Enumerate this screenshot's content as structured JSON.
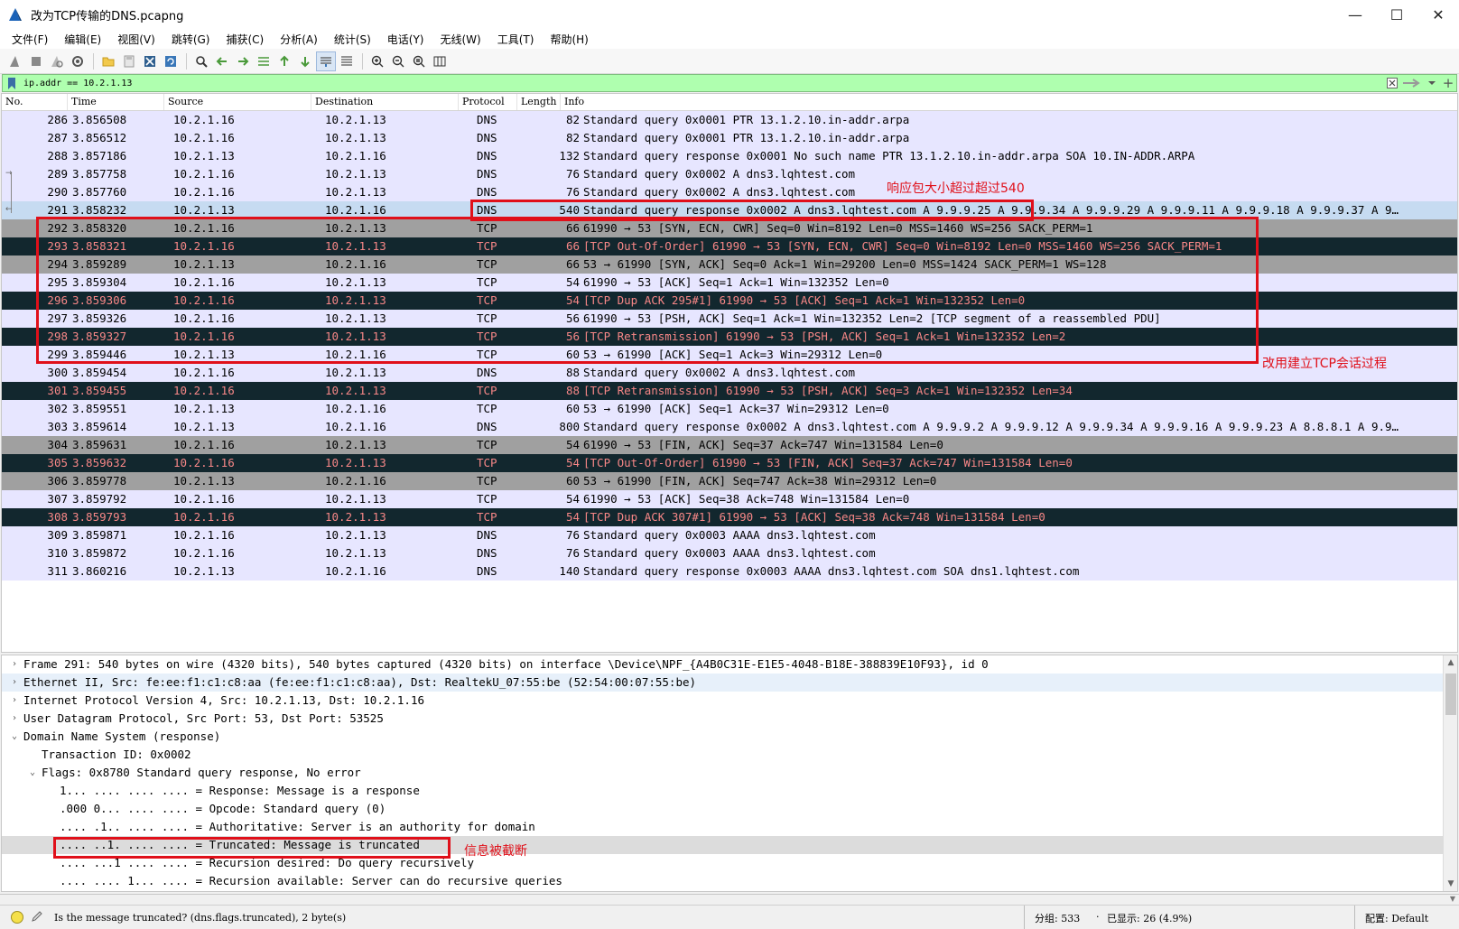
{
  "window": {
    "title": "改为TCP传输的DNS.pcapng",
    "minimize": "—",
    "maximize": "☐",
    "close": "✕"
  },
  "menu": [
    "文件(F)",
    "编辑(E)",
    "视图(V)",
    "跳转(G)",
    "捕获(C)",
    "分析(A)",
    "统计(S)",
    "电话(Y)",
    "无线(W)",
    "工具(T)",
    "帮助(H)"
  ],
  "toolbar_icons": [
    "shark-fin-start-icon",
    "stop-icon",
    "restart-icon",
    "options-gear-icon",
    "open-folder-icon",
    "save-icon",
    "close-file-icon",
    "reload-icon",
    "find-icon",
    "go-back-icon",
    "go-forward-icon",
    "go-to-packet-icon",
    "first-packet-icon",
    "last-packet-icon",
    "autoscroll-icon",
    "colorize-icon",
    "zoom-in-icon",
    "zoom-out-icon",
    "zoom-normal-icon",
    "resize-columns-icon"
  ],
  "filter": {
    "value": "ip.addr == 10.2.1.13",
    "bg_color": "#afffaf"
  },
  "columns": [
    "No.",
    "Time",
    "Source",
    "Destination",
    "Protocol",
    "Length",
    "Info"
  ],
  "colors": {
    "dns_bg": "#e7e6ff",
    "tcp_gray_bg": "#a0a0a0",
    "tcp_light_bg": "#e7e6ff",
    "bad_bg": "#12272e",
    "bad_fg": "#f78787",
    "selected_bg": "#c6dbf1",
    "tcp_plain_bg": "#e7e6ff",
    "annotation": "#e0101a"
  },
  "packets": [
    {
      "no": "286",
      "time": "3.856508",
      "src": "10.2.1.16",
      "dst": "10.2.1.13",
      "proto": "DNS",
      "len": "82",
      "info": "Standard query 0x0001 PTR 13.1.2.10.in-addr.arpa",
      "style": "dns"
    },
    {
      "no": "287",
      "time": "3.856512",
      "src": "10.2.1.16",
      "dst": "10.2.1.13",
      "proto": "DNS",
      "len": "82",
      "info": "Standard query 0x0001 PTR 13.1.2.10.in-addr.arpa",
      "style": "dns"
    },
    {
      "no": "288",
      "time": "3.857186",
      "src": "10.2.1.13",
      "dst": "10.2.1.16",
      "proto": "DNS",
      "len": "132",
      "info": "Standard query response 0x0001 No such name PTR 13.1.2.10.in-addr.arpa SOA 10.IN-ADDR.ARPA",
      "style": "dns"
    },
    {
      "no": "289",
      "time": "3.857758",
      "src": "10.2.1.16",
      "dst": "10.2.1.13",
      "proto": "DNS",
      "len": "76",
      "info": "Standard query 0x0002 A dns3.lqhtest.com",
      "style": "dns"
    },
    {
      "no": "290",
      "time": "3.857760",
      "src": "10.2.1.16",
      "dst": "10.2.1.13",
      "proto": "DNS",
      "len": "76",
      "info": "Standard query 0x0002 A dns3.lqhtest.com",
      "style": "dns"
    },
    {
      "no": "291",
      "time": "3.858232",
      "src": "10.2.1.13",
      "dst": "10.2.1.16",
      "proto": "DNS",
      "len": "540",
      "info": "Standard query response 0x0002 A dns3.lqhtest.com A 9.9.9.25 A 9.9.9.34 A 9.9.9.29 A 9.9.9.11 A 9.9.9.18 A 9.9.9.37 A 9…",
      "style": "selected"
    },
    {
      "no": "292",
      "time": "3.858320",
      "src": "10.2.1.16",
      "dst": "10.2.1.13",
      "proto": "TCP",
      "len": "66",
      "info": "61990 → 53 [SYN, ECN, CWR] Seq=0 Win=8192 Len=0 MSS=1460 WS=256 SACK_PERM=1",
      "style": "gray"
    },
    {
      "no": "293",
      "time": "3.858321",
      "src": "10.2.1.16",
      "dst": "10.2.1.13",
      "proto": "TCP",
      "len": "66",
      "info": "[TCP Out-Of-Order] 61990 → 53 [SYN, ECN, CWR] Seq=0 Win=8192 Len=0 MSS=1460 WS=256 SACK_PERM=1",
      "style": "bad"
    },
    {
      "no": "294",
      "time": "3.859289",
      "src": "10.2.1.13",
      "dst": "10.2.1.16",
      "proto": "TCP",
      "len": "66",
      "info": "53 → 61990 [SYN, ACK] Seq=0 Ack=1 Win=29200 Len=0 MSS=1424 SACK_PERM=1 WS=128",
      "style": "gray"
    },
    {
      "no": "295",
      "time": "3.859304",
      "src": "10.2.1.16",
      "dst": "10.2.1.13",
      "proto": "TCP",
      "len": "54",
      "info": "61990 → 53 [ACK] Seq=1 Ack=1 Win=132352 Len=0",
      "style": "tcp"
    },
    {
      "no": "296",
      "time": "3.859306",
      "src": "10.2.1.16",
      "dst": "10.2.1.13",
      "proto": "TCP",
      "len": "54",
      "info": "[TCP Dup ACK 295#1] 61990 → 53 [ACK] Seq=1 Ack=1 Win=132352 Len=0",
      "style": "bad"
    },
    {
      "no": "297",
      "time": "3.859326",
      "src": "10.2.1.16",
      "dst": "10.2.1.13",
      "proto": "TCP",
      "len": "56",
      "info": "61990 → 53 [PSH, ACK] Seq=1 Ack=1 Win=132352 Len=2 [TCP segment of a reassembled PDU]",
      "style": "tcp"
    },
    {
      "no": "298",
      "time": "3.859327",
      "src": "10.2.1.16",
      "dst": "10.2.1.13",
      "proto": "TCP",
      "len": "56",
      "info": "[TCP Retransmission] 61990 → 53 [PSH, ACK] Seq=1 Ack=1 Win=132352 Len=2",
      "style": "bad"
    },
    {
      "no": "299",
      "time": "3.859446",
      "src": "10.2.1.13",
      "dst": "10.2.1.16",
      "proto": "TCP",
      "len": "60",
      "info": "53 → 61990 [ACK] Seq=1 Ack=3 Win=29312 Len=0",
      "style": "tcp"
    },
    {
      "no": "300",
      "time": "3.859454",
      "src": "10.2.1.16",
      "dst": "10.2.1.13",
      "proto": "DNS",
      "len": "88",
      "info": "Standard query 0x0002 A dns3.lqhtest.com",
      "style": "dns"
    },
    {
      "no": "301",
      "time": "3.859455",
      "src": "10.2.1.16",
      "dst": "10.2.1.13",
      "proto": "TCP",
      "len": "88",
      "info": "[TCP Retransmission] 61990 → 53 [PSH, ACK] Seq=3 Ack=1 Win=132352 Len=34",
      "style": "bad"
    },
    {
      "no": "302",
      "time": "3.859551",
      "src": "10.2.1.13",
      "dst": "10.2.1.16",
      "proto": "TCP",
      "len": "60",
      "info": "53 → 61990 [ACK] Seq=1 Ack=37 Win=29312 Len=0",
      "style": "tcp"
    },
    {
      "no": "303",
      "time": "3.859614",
      "src": "10.2.1.13",
      "dst": "10.2.1.16",
      "proto": "DNS",
      "len": "800",
      "info": "Standard query response 0x0002 A dns3.lqhtest.com A 9.9.9.2 A 9.9.9.12 A 9.9.9.34 A 9.9.9.16 A 9.9.9.23 A 8.8.8.1 A 9.9…",
      "style": "dns"
    },
    {
      "no": "304",
      "time": "3.859631",
      "src": "10.2.1.16",
      "dst": "10.2.1.13",
      "proto": "TCP",
      "len": "54",
      "info": "61990 → 53 [FIN, ACK] Seq=37 Ack=747 Win=131584 Len=0",
      "style": "gray"
    },
    {
      "no": "305",
      "time": "3.859632",
      "src": "10.2.1.16",
      "dst": "10.2.1.13",
      "proto": "TCP",
      "len": "54",
      "info": "[TCP Out-Of-Order] 61990 → 53 [FIN, ACK] Seq=37 Ack=747 Win=131584 Len=0",
      "style": "bad"
    },
    {
      "no": "306",
      "time": "3.859778",
      "src": "10.2.1.13",
      "dst": "10.2.1.16",
      "proto": "TCP",
      "len": "60",
      "info": "53 → 61990 [FIN, ACK] Seq=747 Ack=38 Win=29312 Len=0",
      "style": "gray"
    },
    {
      "no": "307",
      "time": "3.859792",
      "src": "10.2.1.16",
      "dst": "10.2.1.13",
      "proto": "TCP",
      "len": "54",
      "info": "61990 → 53 [ACK] Seq=38 Ack=748 Win=131584 Len=0",
      "style": "tcp"
    },
    {
      "no": "308",
      "time": "3.859793",
      "src": "10.2.1.16",
      "dst": "10.2.1.13",
      "proto": "TCP",
      "len": "54",
      "info": "[TCP Dup ACK 307#1] 61990 → 53 [ACK] Seq=38 Ack=748 Win=131584 Len=0",
      "style": "bad"
    },
    {
      "no": "309",
      "time": "3.859871",
      "src": "10.2.1.16",
      "dst": "10.2.1.13",
      "proto": "DNS",
      "len": "76",
      "info": "Standard query 0x0003 AAAA dns3.lqhtest.com",
      "style": "dns"
    },
    {
      "no": "310",
      "time": "3.859872",
      "src": "10.2.1.16",
      "dst": "10.2.1.13",
      "proto": "DNS",
      "len": "76",
      "info": "Standard query 0x0003 AAAA dns3.lqhtest.com",
      "style": "dns"
    },
    {
      "no": "311",
      "time": "3.860216",
      "src": "10.2.1.13",
      "dst": "10.2.1.16",
      "proto": "DNS",
      "len": "140",
      "info": "Standard query response 0x0003 AAAA dns3.lqhtest.com SOA dns1.lqhtest.com",
      "style": "dns"
    }
  ],
  "details": [
    {
      "twisty": "›",
      "indent": 0,
      "text": "Frame 291: 540 bytes on wire (4320 bits), 540 bytes captured (4320 bits) on interface \\Device\\NPF_{A4B0C31E-E1E5-4048-B18E-388839E10F93}, id 0",
      "hl": false
    },
    {
      "twisty": "›",
      "indent": 0,
      "text": "Ethernet II, Src: fe:ee:f1:c1:c8:aa (fe:ee:f1:c1:c8:aa), Dst: RealtekU_07:55:be (52:54:00:07:55:be)",
      "hl": "blue"
    },
    {
      "twisty": "›",
      "indent": 0,
      "text": "Internet Protocol Version 4, Src: 10.2.1.13, Dst: 10.2.1.16",
      "hl": false
    },
    {
      "twisty": "›",
      "indent": 0,
      "text": "User Datagram Protocol, Src Port: 53, Dst Port: 53525",
      "hl": false
    },
    {
      "twisty": "⌄",
      "indent": 0,
      "text": "Domain Name System (response)",
      "hl": false
    },
    {
      "twisty": "",
      "indent": 1,
      "text": "Transaction ID: 0x0002",
      "hl": false
    },
    {
      "twisty": "⌄",
      "indent": 1,
      "text": "Flags: 0x8780 Standard query response, No error",
      "hl": false
    },
    {
      "twisty": "",
      "indent": 2,
      "text": "1... .... .... .... = Response: Message is a response",
      "hl": false
    },
    {
      "twisty": "",
      "indent": 2,
      "text": ".000 0... .... .... = Opcode: Standard query (0)",
      "hl": false
    },
    {
      "twisty": "",
      "indent": 2,
      "text": ".... .1.. .... .... = Authoritative: Server is an authority for domain",
      "hl": false
    },
    {
      "twisty": "",
      "indent": 2,
      "text": ".... ..1. .... .... = Truncated: Message is truncated",
      "hl": "gray"
    },
    {
      "twisty": "",
      "indent": 2,
      "text": ".... ...1 .... .... = Recursion desired: Do query recursively",
      "hl": false
    },
    {
      "twisty": "",
      "indent": 2,
      "text": ".... .... 1... .... = Recursion available: Server can do recursive queries",
      "hl": false
    }
  ],
  "annotations": {
    "size_note": "响应包大小超过超过540",
    "tcp_note": "改用建立TCP会话过程",
    "truncated_note": "信息被截断"
  },
  "status": {
    "message": "Is the message truncated? (dns.flags.truncated), 2 byte(s)",
    "packets": "分组: 533",
    "displayed": "已显示: 26 (4.9%)",
    "profile": "配置: Default"
  }
}
